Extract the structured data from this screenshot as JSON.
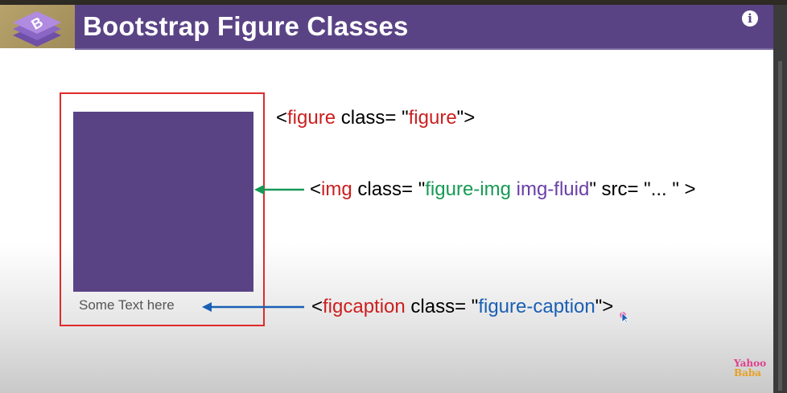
{
  "header": {
    "title": "Bootstrap Figure Classes",
    "info_icon": "info-icon"
  },
  "logo": {
    "letter": "B",
    "icon": "bootstrap-logo-icon"
  },
  "figure": {
    "caption": "Some Text here"
  },
  "code_lines": {
    "figure": {
      "open": "<",
      "tag": "figure",
      "attr": " class= \"",
      "value": "figure",
      "close": "\">"
    },
    "img": {
      "open": "<",
      "tag": "img",
      "attr": " class= \"",
      "value1": "figure-img",
      "value2": " img-fluid",
      "rest": "\" src= \"... \" >"
    },
    "figcaption": {
      "open": "<",
      "tag": "figcaption",
      "attr": " class= \"",
      "value": "figure-caption",
      "close": "\">"
    }
  },
  "colors": {
    "header_bg": "#5a4385",
    "highlight_red": "#e02a2a",
    "arrow_green": "#169a55",
    "arrow_blue": "#1a5fb4"
  },
  "watermark": {
    "line1": "Yahoo",
    "line2": "Baba"
  }
}
